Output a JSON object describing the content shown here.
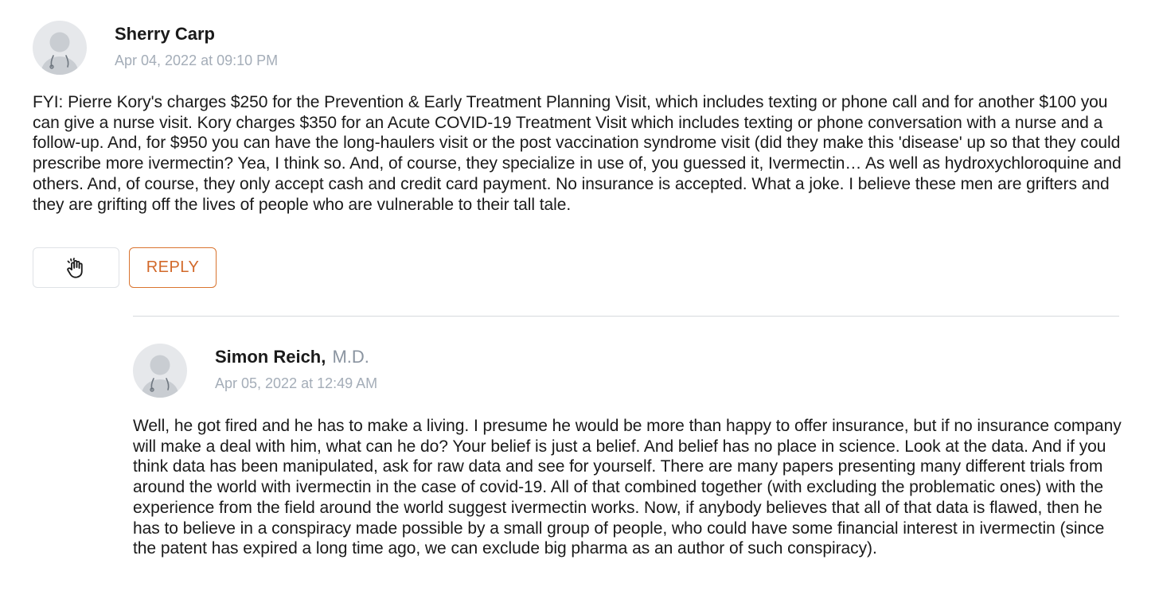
{
  "comments": [
    {
      "author": "Sherry Carp",
      "credential": "",
      "date": "Apr 04, 2022 at 09:10 PM",
      "text": "FYI: Pierre Kory's charges $250 for the Prevention & Early Treatment Planning Visit, which includes texting or phone call and for another $100 you can give a nurse visit. Kory charges $350 for an Acute COVID-19 Treatment Visit which includes texting or phone conversation with a nurse and a follow-up. And, for $950 you can have the long-haulers visit or the post vaccination syndrome visit (did they make this 'disease' up so that they could prescribe more ivermectin? Yea, I think so. And, of course, they specialize in use of, you guessed it, Ivermectin… As well as hydroxychloroquine and others. And, of course, they only accept cash and credit card payment. No insurance is accepted. What a joke. I believe these men are grifters and they are grifting off the lives of people who are vulnerable to their tall tale."
    },
    {
      "author": "Simon Reich,",
      "credential": "M.D.",
      "date": "Apr 05, 2022 at 12:49 AM",
      "text": "Well, he got fired and he has to make a living. I presume he would be more than happy to offer insurance, but if no insurance company will make a deal with him, what can he do? Your belief is just a belief. And belief has no place in science. Look at the data. And if you think data has been manipulated, ask for raw data and see for yourself. There are many papers presenting many different trials from around the world with ivermectin in the case of covid-19. All of that combined together (with excluding the problematic ones) with the experience from the field around the world suggest ivermectin works. Now, if anybody believes that all of that data is flawed, then he has to believe in a conspiracy made possible by a small group of people, who could have some financial interest in ivermectin (since the patent has expired a long time ago, we can exclude big pharma as an author of such conspiracy)."
    }
  ],
  "actions": {
    "react_icon": "clapping-hand-icon",
    "reply_label": "REPLY"
  },
  "colors": {
    "accent": "#d9742f",
    "muted_text": "#a4adb8",
    "avatar_bg": "#e6e8eb",
    "divider": "#d6d9dd"
  }
}
